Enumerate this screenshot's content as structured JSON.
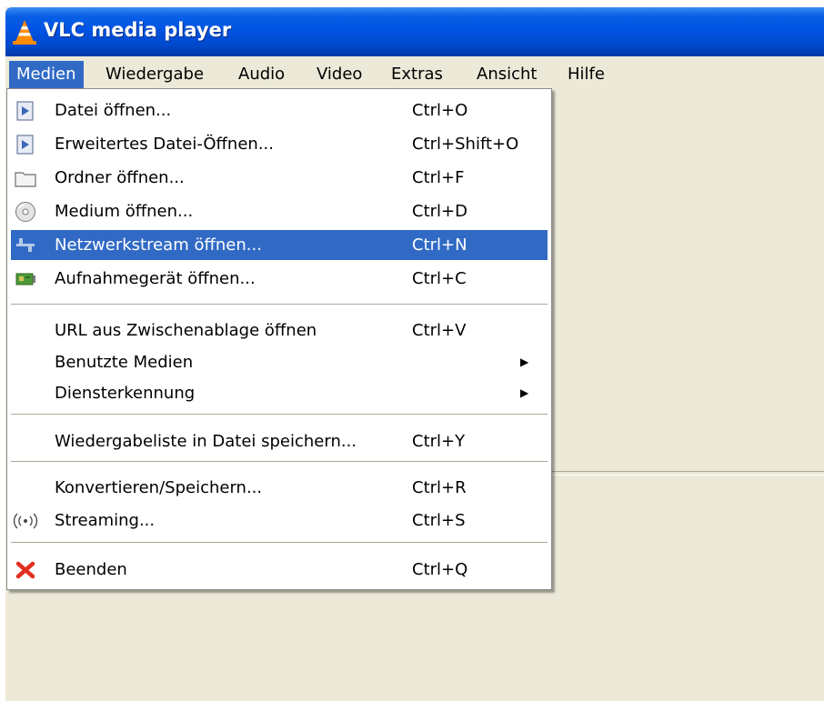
{
  "window": {
    "title": "VLC media player"
  },
  "menubar": {
    "items": [
      {
        "label": "Medien",
        "active": true
      },
      {
        "label": "Wiedergabe"
      },
      {
        "label": "Audio"
      },
      {
        "label": "Video"
      },
      {
        "label": "Extras"
      },
      {
        "label": "Ansicht"
      },
      {
        "label": "Hilfe"
      }
    ]
  },
  "media_menu": {
    "items": [
      {
        "label": "Datei öffnen...",
        "shortcut": "Ctrl+O",
        "icon": "play-file-icon"
      },
      {
        "label": "Erweitertes Datei-Öffnen...",
        "shortcut": "Ctrl+Shift+O",
        "icon": "play-file-icon"
      },
      {
        "label": "Ordner öffnen...",
        "shortcut": "Ctrl+F",
        "icon": "folder-icon"
      },
      {
        "label": "Medium öffnen...",
        "shortcut": "Ctrl+D",
        "icon": "disc-icon"
      },
      {
        "label": "Netzwerkstream öffnen...",
        "shortcut": "Ctrl+N",
        "icon": "network-icon",
        "highlighted": true
      },
      {
        "label": "Aufnahmegerät öffnen...",
        "shortcut": "Ctrl+C",
        "icon": "capture-card-icon"
      },
      {
        "label": "URL aus Zwischenablage öffnen",
        "shortcut": "Ctrl+V"
      },
      {
        "label": "Benutzte Medien",
        "submenu": true
      },
      {
        "label": "Diensterkennung",
        "submenu": true
      },
      {
        "label": "Wiedergabeliste in Datei speichern...",
        "shortcut": "Ctrl+Y"
      },
      {
        "label": "Konvertieren/Speichern...",
        "shortcut": "Ctrl+R"
      },
      {
        "label": "Streaming...",
        "shortcut": "Ctrl+S",
        "icon": "streaming-icon"
      },
      {
        "label": "Beenden",
        "shortcut": "Ctrl+Q",
        "icon": "close-red-icon"
      }
    ]
  },
  "colors": {
    "titlebar": "#0054e3",
    "highlight": "#316ac5",
    "window_bg": "#ece9d8"
  }
}
